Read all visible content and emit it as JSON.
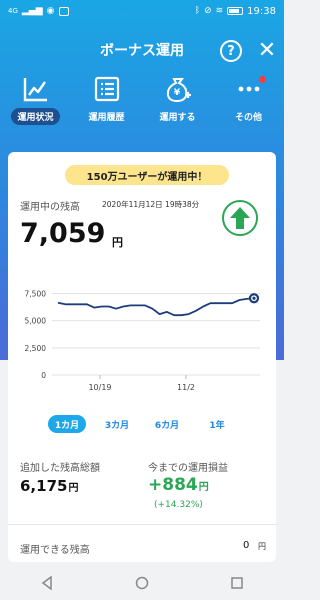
{
  "status_bar": {
    "signal": "4G",
    "time": "19:38"
  },
  "header": {
    "title": "ボーナス運用",
    "help": "?",
    "close": "✕"
  },
  "nav": [
    {
      "label": "運用状況",
      "icon": "chart-line-icon"
    },
    {
      "label": "運用履歴",
      "icon": "list-icon"
    },
    {
      "label": "運用する",
      "icon": "money-bag-plus-icon"
    },
    {
      "label": "その他",
      "icon": "more-icon"
    }
  ],
  "promo": "150万ユーザーが運用中！",
  "balance": {
    "label": "運用中の残高",
    "timestamp": "2020年11月12日 19時38分",
    "value": "7,059",
    "unit": "円"
  },
  "chart_data": {
    "type": "line",
    "x_labels": [
      "10/19",
      "11/2"
    ],
    "y_ticks": [
      "7,500",
      "5,000",
      "2,500",
      "0"
    ],
    "ylim": [
      0,
      8000
    ],
    "grid": true,
    "values": [
      6650,
      6500,
      6500,
      6500,
      6500,
      6200,
      6300,
      6300,
      6100,
      6300,
      6400,
      6400,
      6400,
      6100,
      5600,
      5800,
      5500,
      5500,
      5600,
      5900,
      6300,
      6600,
      6600,
      6600,
      6600,
      6900,
      7000,
      7059
    ]
  },
  "periods": [
    "1カ月",
    "3カ月",
    "6カ月",
    "1年"
  ],
  "added": {
    "label": "追加した残高総額",
    "value": "6,175",
    "unit": "円"
  },
  "pnl": {
    "label": "今までの運用損益",
    "value": "+884",
    "unit": "円",
    "percent": "(+14.32%)"
  },
  "available": {
    "label": "運用できる残高",
    "value": "0",
    "unit": "円"
  }
}
